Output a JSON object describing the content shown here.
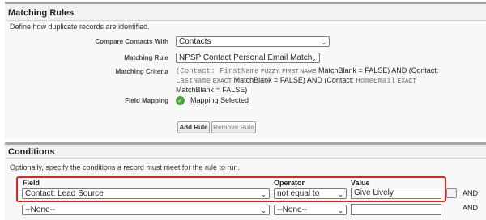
{
  "matching_rules": {
    "title": "Matching Rules",
    "description": "Define how duplicate records are identified.",
    "compare_label": "Compare Contacts With",
    "compare_value": "Contacts",
    "rule_label": "Matching Rule",
    "rule_value": "NPSP Contact Personal Email Match",
    "criteria_label": "Matching Criteria",
    "criteria": {
      "p1": "(Contact: FirstName",
      "k1": "FUZZY: FIRST NAME",
      "p2": "MatchBlank = FALSE) AND (Contact:",
      "p3": "LastName",
      "k2": "EXACT",
      "p4": "MatchBlank = FALSE) AND (Contact:",
      "p5": "HomeEmail",
      "k3": "EXACT",
      "p6": "MatchBlank = FALSE)"
    },
    "field_mapping_label": "Field Mapping",
    "field_mapping_link": "Mapping Selected",
    "add_rule": "Add Rule",
    "remove_rule": "Remove Rule"
  },
  "conditions": {
    "title": "Conditions",
    "description": "Optionally, specify the conditions a record must meet for the rule to run.",
    "headers": {
      "field": "Field",
      "operator": "Operator",
      "value": "Value"
    },
    "rows": [
      {
        "field": "Contact: Lead Source",
        "operator": "not equal to",
        "value": "Give Lively",
        "conj": "AND"
      },
      {
        "field": "--None--",
        "operator": "--None--",
        "value": "",
        "conj": "AND"
      }
    ]
  },
  "colors": {
    "highlight": "#e3241b",
    "check": "#4aa33c"
  }
}
